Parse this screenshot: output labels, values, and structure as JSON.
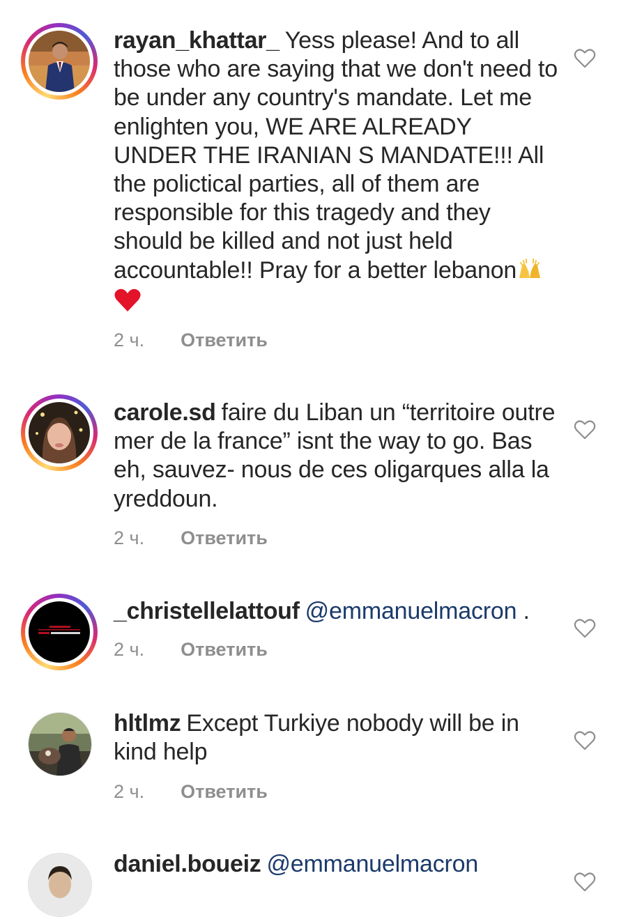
{
  "comments": [
    {
      "username": "rayan_khattar_",
      "text": "Yess please! And to all those who are saying that we don't need to be under any country's mandate. Let me enlighten you, WE ARE ALREADY UNDER THE IRANIAN S MANDATE!!! All the polictical parties, all of them are responsible for this tragedy and they should be killed and not just held accountable!! Pray for a better lebanon",
      "emoji_icons": [
        "raising-hands-icon",
        "red-heart-icon"
      ],
      "time": "2 ч.",
      "reply_label": "Ответить"
    },
    {
      "username": "carole.sd",
      "text": "faire du Liban un “territoire outre mer de la france” isnt the way to go. Bas eh, sauvez- nous de ces oligarques alla la yreddoun.",
      "time": "2 ч.",
      "reply_label": "Ответить"
    },
    {
      "username": "_christellelattouf",
      "mention": "@emmanuelmacron",
      "text": " .",
      "time": "2 ч.",
      "reply_label": "Ответить"
    },
    {
      "username": "hltlmz",
      "text": "Except Turkiye nobody will be in kind help",
      "time": "2 ч.",
      "reply_label": "Ответить"
    },
    {
      "username": "daniel.boueiz",
      "mention": "@emmanuelmacron"
    }
  ],
  "colors": {
    "mention": "#1b3a6b",
    "meta": "#8e8e8e",
    "text": "#262626"
  }
}
